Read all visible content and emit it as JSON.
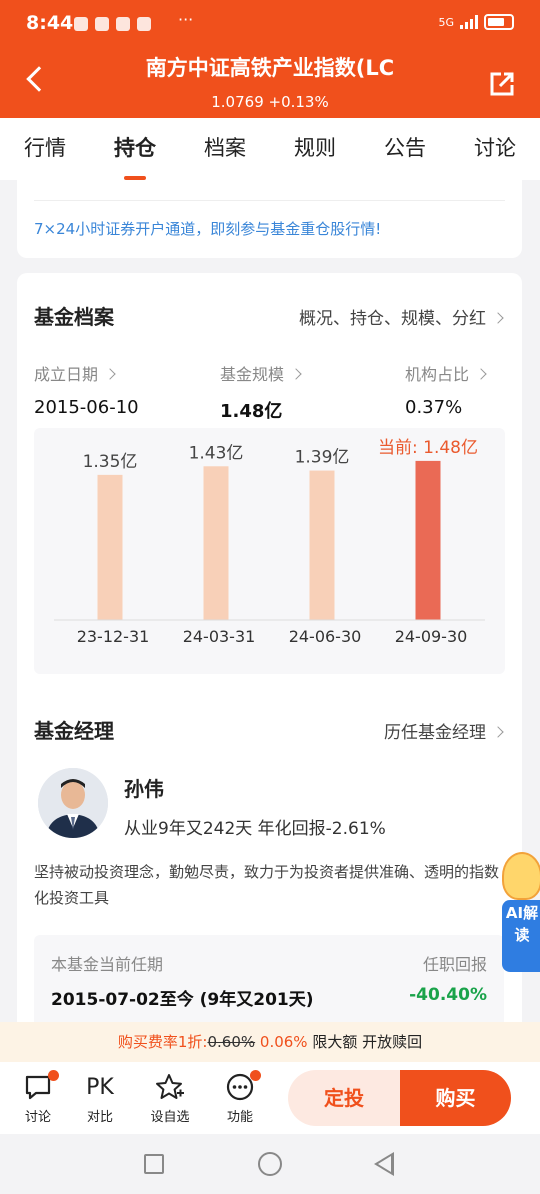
{
  "status_bar": {
    "time": "8:44",
    "dots": "···",
    "network": "5G"
  },
  "header": {
    "title": "南方中证高铁产业指数(LC",
    "nav_value": "1.0769 +0.13%"
  },
  "tabs": [
    {
      "label": "行情",
      "active": false
    },
    {
      "label": "持仓",
      "active": true
    },
    {
      "label": "档案",
      "active": false
    },
    {
      "label": "规则",
      "active": false
    },
    {
      "label": "公告",
      "active": false
    },
    {
      "label": "讨论",
      "active": false
    }
  ],
  "promo": {
    "text": "7×24小时证券开户通道，即刻参与基金重仓股行情!"
  },
  "profile": {
    "title": "基金档案",
    "link": "概况、持仓、规模、分红",
    "stats": [
      {
        "label": "成立日期",
        "value": "2015-06-10"
      },
      {
        "label": "基金规模",
        "value": "1.48亿"
      },
      {
        "label": "机构占比",
        "value": "0.37%"
      }
    ]
  },
  "chart_data": {
    "type": "bar",
    "categories": [
      "23-12-31",
      "24-03-31",
      "24-06-30",
      "24-09-30"
    ],
    "values": [
      1.35,
      1.43,
      1.39,
      1.48
    ],
    "data_labels": [
      "1.35亿",
      "1.43亿",
      "1.39亿",
      "当前: 1.48亿"
    ],
    "ylim": [
      0,
      1.6
    ],
    "colors": {
      "bar": "#f8d0b8",
      "current_bar": "#ea6a55",
      "current_label": "#ea5a2e",
      "label": "#444444"
    }
  },
  "manager": {
    "title": "基金经理",
    "link": "历任基金经理",
    "name": "孙伟",
    "meta": "从业9年又242天 年化回报-2.61%",
    "desc": "坚持被动投资理念，勤勉尽责，致力于为投资者提供准确、透明的指数化投资工具",
    "tenure_label": "本基金当前任期",
    "tenure_value": "2015-07-02至今 (9年又201天)",
    "return_label": "任职回报",
    "return_value": "-40.40%"
  },
  "ai_tab": {
    "label": "AI解读"
  },
  "fee_bar": {
    "prefix": "购买费率1折:",
    "old_rate": "0.60%",
    "new_rate": "0.06%",
    "suffix": "限大额 开放赎回"
  },
  "actions": [
    {
      "label": "讨论",
      "icon": "chat-icon",
      "dot": true
    },
    {
      "label": "对比",
      "icon": "PK",
      "dot": false
    },
    {
      "label": "设自选",
      "icon": "star-plus-icon",
      "dot": false
    },
    {
      "label": "功能",
      "icon": "more-icon",
      "dot": true
    }
  ],
  "buttons": {
    "dingtou": "定投",
    "buy": "购买"
  }
}
